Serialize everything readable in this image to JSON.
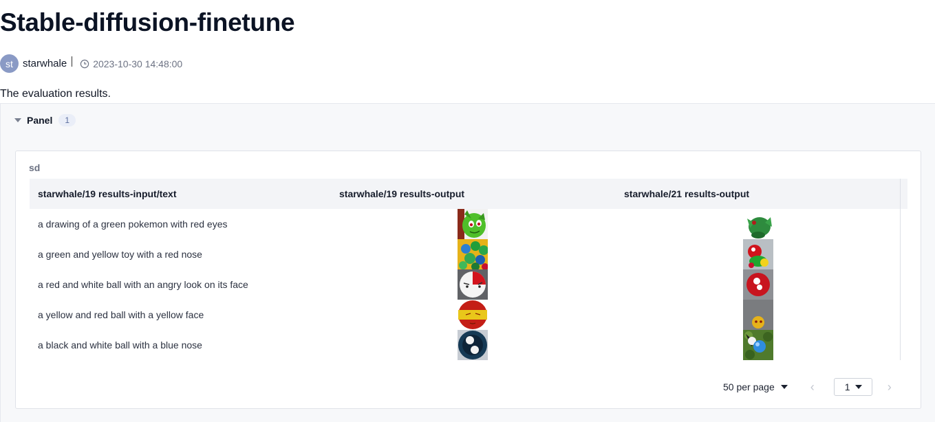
{
  "page": {
    "title": "Stable-diffusion-finetune",
    "author_initials": "st",
    "author": "starwhale",
    "timestamp": "2023-10-30 14:48:00",
    "description": "The evaluation results."
  },
  "panel": {
    "title": "Panel",
    "count": "1",
    "card_title": "sd"
  },
  "table": {
    "columns": [
      "starwhale/19 results-input/text",
      "starwhale/19 results-output",
      "starwhale/21 results-output"
    ],
    "rows": [
      {
        "text": "a drawing of a green pokemon with red eyes",
        "out19": "green-pokemon-image",
        "out21": "green-creature-image"
      },
      {
        "text": "a green and yellow toy with a red nose",
        "out19": "colorful-balls-image",
        "out21": "red-green-toy-image"
      },
      {
        "text": "a red and white ball with an angry look on its face",
        "out19": "angry-ball-image",
        "out21": "red-white-ball-image"
      },
      {
        "text": "a yellow and red ball with a yellow face",
        "out19": "red-yellow-ball-image",
        "out21": "yellow-face-image"
      },
      {
        "text": "a black and white ball with a blue nose",
        "out19": "black-white-ball-image",
        "out21": "blue-nose-image"
      }
    ]
  },
  "pagination": {
    "per_page": "50 per page",
    "page": "1",
    "prev": "‹",
    "next": "›"
  },
  "icons": {
    "clock": "clock-icon",
    "caret": "caret-down-icon"
  }
}
